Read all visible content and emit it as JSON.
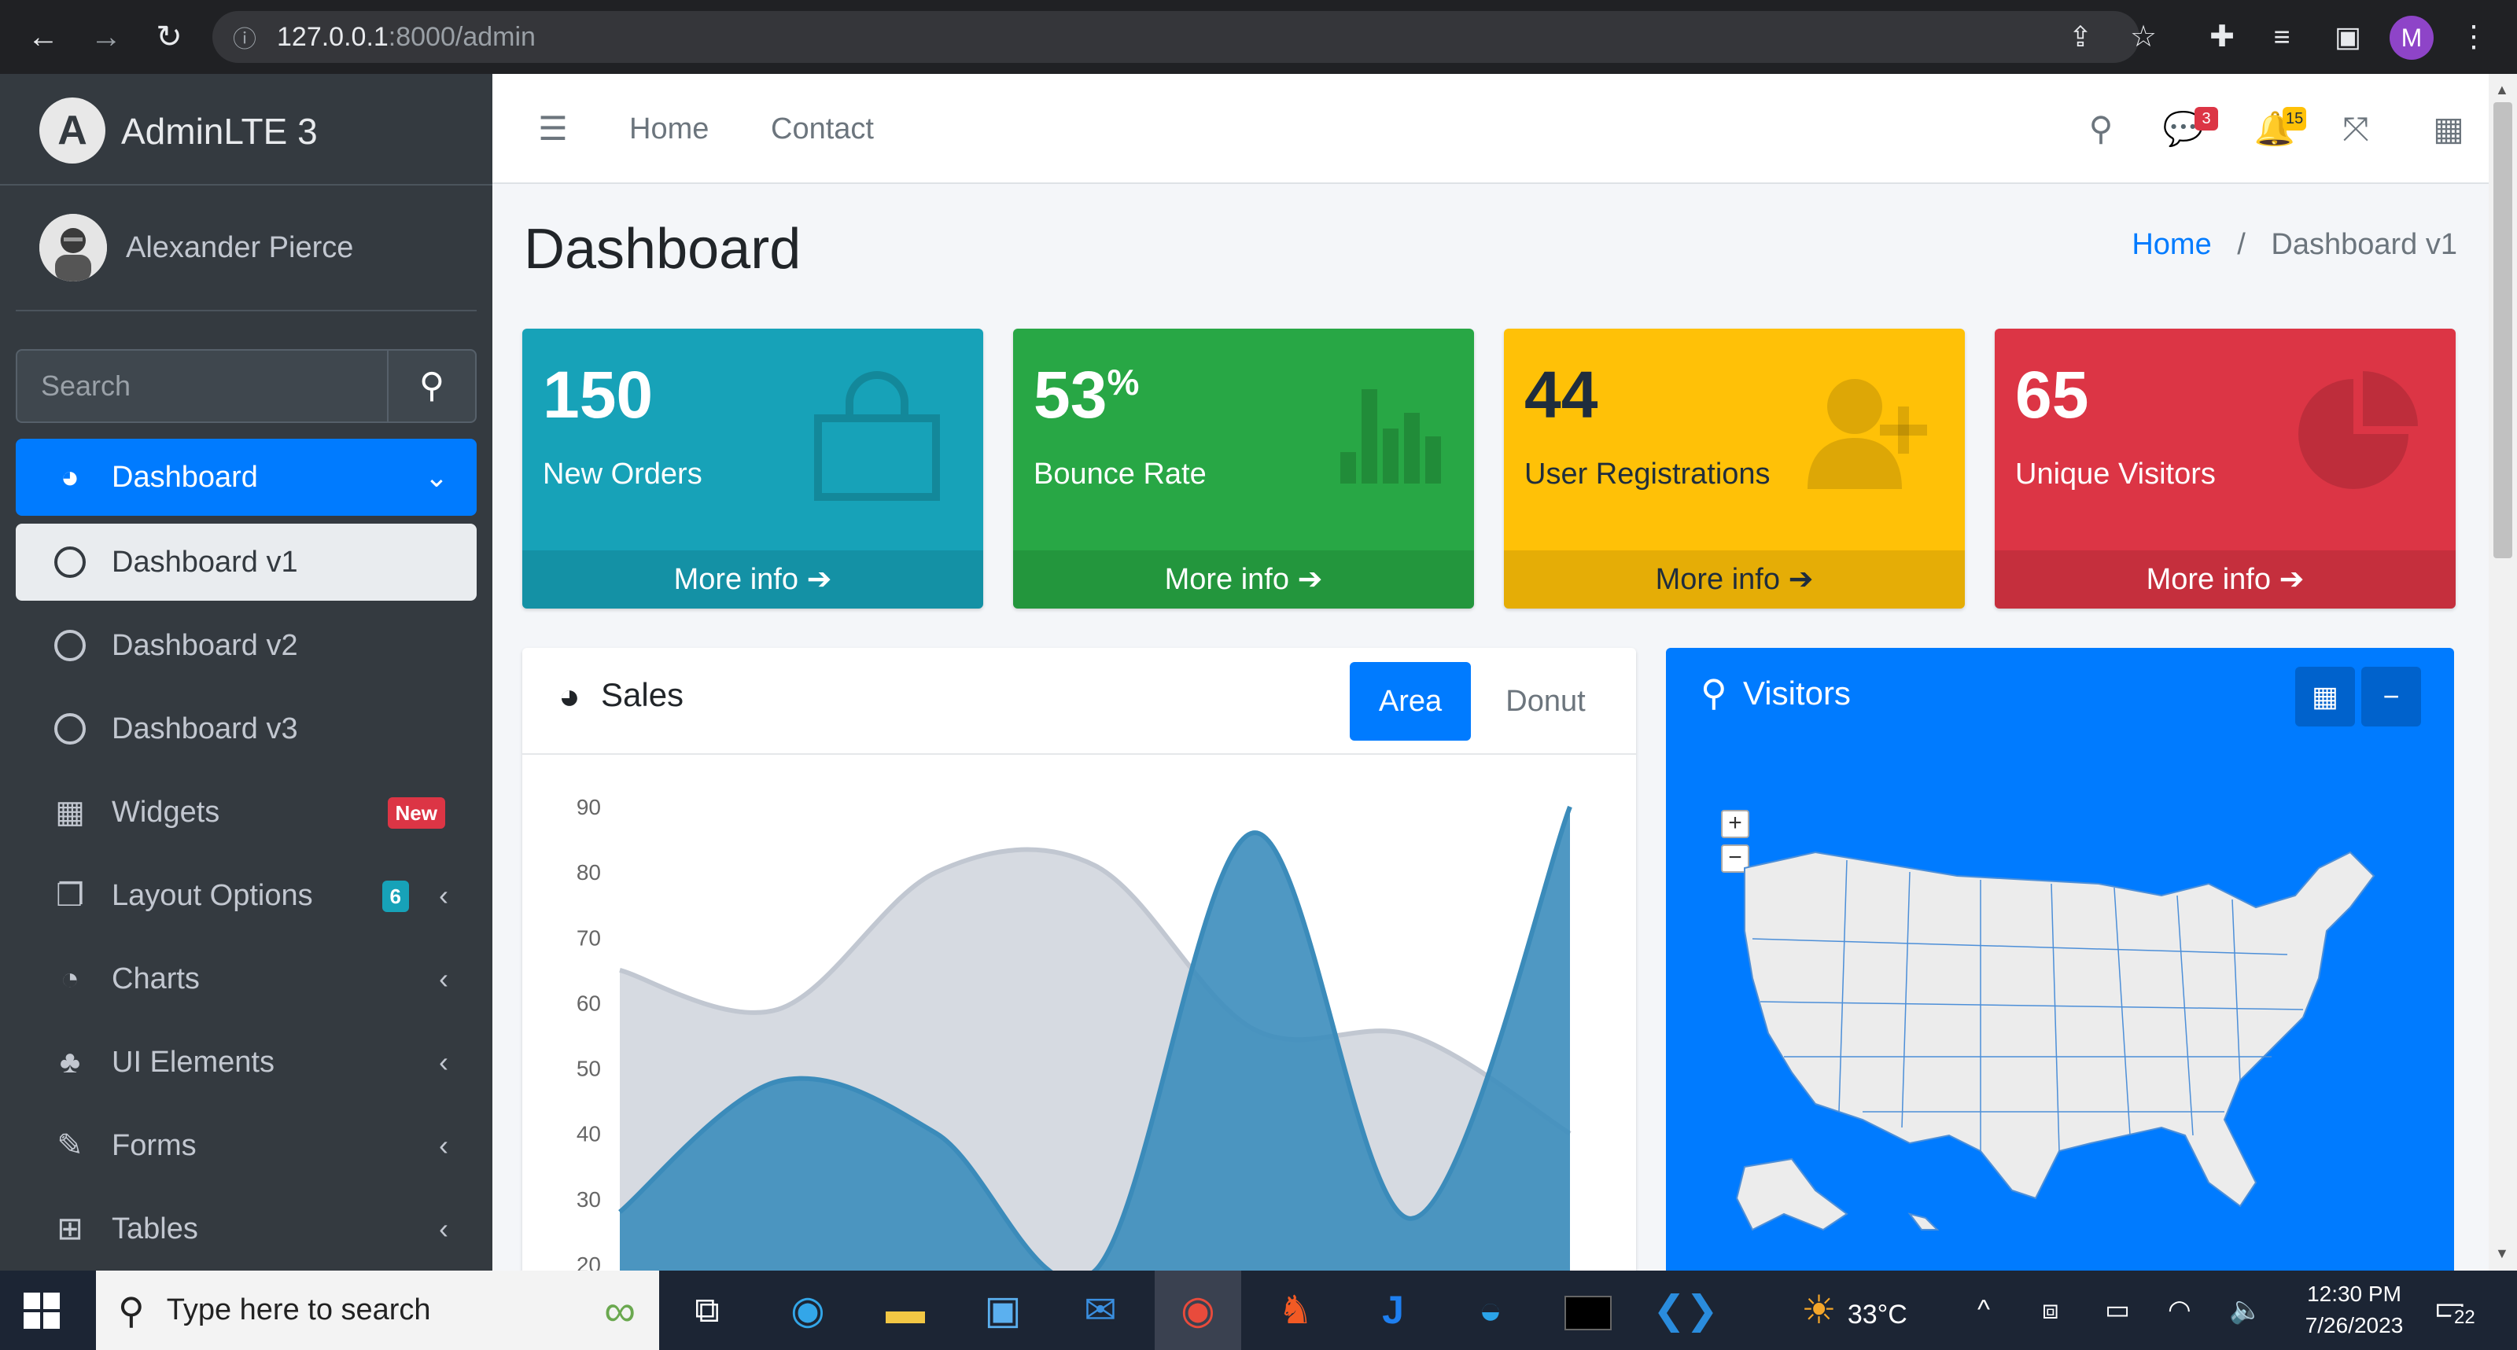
{
  "browser": {
    "url_host": "127.0.0.1",
    "url_path": ":8000/admin"
  },
  "sidebar": {
    "brand": "AdminLTE 3",
    "user_name": "Alexander Pierce",
    "search_placeholder": "Search",
    "items": [
      {
        "label": "Dashboard"
      },
      {
        "label": "Dashboard v1"
      },
      {
        "label": "Dashboard v2"
      },
      {
        "label": "Dashboard v3"
      },
      {
        "label": "Widgets",
        "badge": "New"
      },
      {
        "label": "Layout Options",
        "badge": "6"
      },
      {
        "label": "Charts"
      },
      {
        "label": "UI Elements"
      },
      {
        "label": "Forms"
      },
      {
        "label": "Tables"
      }
    ]
  },
  "topnav": {
    "home": "Home",
    "contact": "Contact",
    "messages_count": "3",
    "notifications_count": "15"
  },
  "page": {
    "title": "Dashboard",
    "breadcrumb_home": "Home",
    "breadcrumb_sep": "/",
    "breadcrumb_current": "Dashboard v1"
  },
  "boxes": [
    {
      "value": "150",
      "suffix": "",
      "label": "New Orders",
      "footer": "More info",
      "color": "#17a2b8"
    },
    {
      "value": "53",
      "suffix": "%",
      "label": "Bounce Rate",
      "footer": "More info",
      "color": "#28a745"
    },
    {
      "value": "44",
      "suffix": "",
      "label": "User Registrations",
      "footer": "More info",
      "color": "#ffc107"
    },
    {
      "value": "65",
      "suffix": "",
      "label": "Unique Visitors",
      "footer": "More info",
      "color": "#dc3545"
    }
  ],
  "sales": {
    "title": "Sales",
    "btn_area": "Area",
    "btn_donut": "Donut"
  },
  "visitors": {
    "title": "Visitors"
  },
  "chart_data": {
    "type": "area",
    "title": "",
    "xlabel": "",
    "ylabel": "",
    "ylim": [
      20,
      90
    ],
    "yticks": [
      "90",
      "80",
      "70",
      "60",
      "50",
      "40",
      "30",
      "20"
    ],
    "series": [
      {
        "values": [
          65,
          59,
          80,
          81,
          56,
          55,
          40
        ],
        "color": "#d2d6de"
      },
      {
        "values": [
          28,
          48,
          40,
          19,
          86,
          27,
          90
        ],
        "color": "#3c8dbc"
      }
    ]
  },
  "taskbar": {
    "search_placeholder": "Type here to search",
    "weather": "33°C",
    "time": "12:30 PM",
    "date": "7/26/2023",
    "notif_count": "22"
  }
}
